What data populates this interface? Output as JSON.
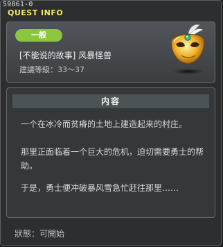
{
  "window": {
    "quest_id": "59861-0",
    "title": "QUEST INFO"
  },
  "header": {
    "category_badge": "一般",
    "quest_name": "[不能说的故事] 风暴怪兽",
    "level_requirement": "建議等級：33～37",
    "icon": "golden-mask-icon"
  },
  "content": {
    "section_title": "内容",
    "paragraphs": [
      "一个在冰冷而贫瘠的土地上建造起来的村庄。",
      "那里正面临着一个巨大的危机，迫切需要勇士的帮助。",
      "于是，勇士便冲破暴风雪急忙赶往那里……"
    ]
  },
  "footer": {
    "status": "狀態：可開始"
  },
  "colors": {
    "title_yellow": "#f4e96a",
    "badge_green": "#8cc63f",
    "panel_bg": "#2c2e30"
  }
}
